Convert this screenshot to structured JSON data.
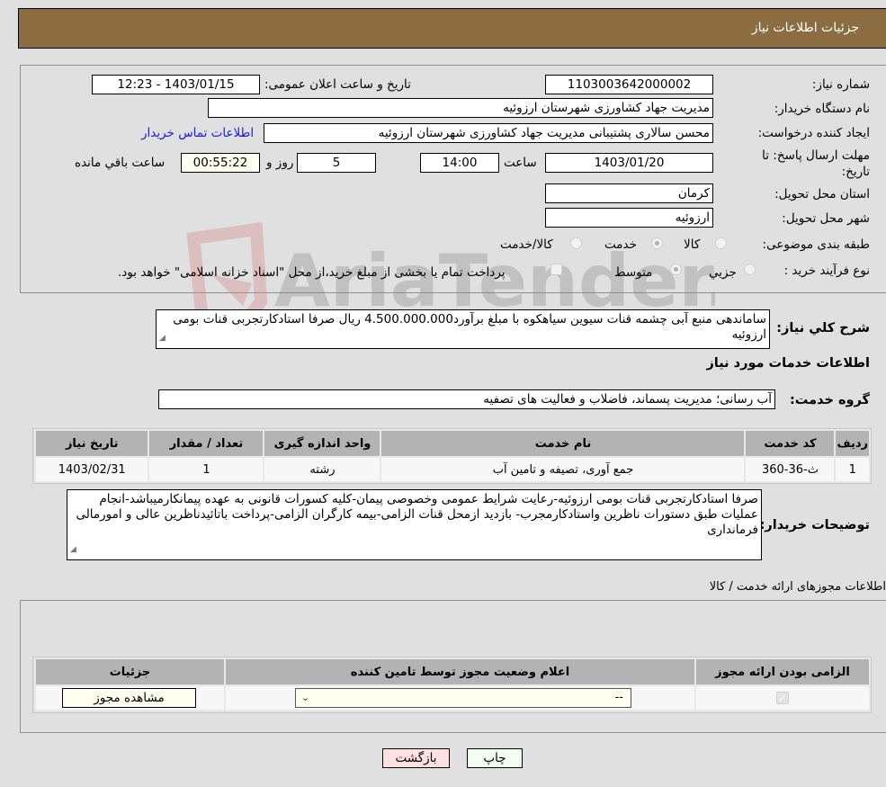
{
  "header": {
    "title": "جزئیات اطلاعات نیاز"
  },
  "form": {
    "need_number_label": "شماره نیاز:",
    "need_number": "1103003642000002",
    "announce_label": "تاریخ و ساعت اعلان عمومی:",
    "announce_value": "1403/01/15 - 12:23",
    "buyer_org_label": "نام دستگاه خریدار:",
    "buyer_org": "مدیریت جهاد کشاورزی شهرستان ارزوئیه",
    "creator_label": "ایجاد کننده درخواست:",
    "creator": "محسن  سالاری پشتیبانی مدیریت جهاد کشاورزی شهرستان ارزوئیه",
    "buyer_contact_link": "اطلاعات تماس خریدار",
    "deadline_label": "مهلت ارسال پاسخ: تا تاریخ:",
    "deadline_date": "1403/01/20",
    "time_label": "ساعت",
    "deadline_time": "14:00",
    "days_value": "5",
    "days_label": "روز و",
    "remaining_time": "00:55:22",
    "remaining_label": "ساعت باقي مانده",
    "province_label": "استان محل تحویل:",
    "province": "کرمان",
    "city_label": "شهر محل تحویل:",
    "city": "ارزوئیه",
    "category_label": "طبقه بندی موضوعی:",
    "category_options": [
      "کالا",
      "خدمت",
      "کالا/خدمت"
    ],
    "category_selected": "خدمت",
    "process_label": "نوع فرآیند خرید :",
    "process_options": [
      "جزیي",
      "متوسط"
    ],
    "process_selected": "متوسط",
    "treasury_note": "پرداخت تمام یا بخشی از مبلغ خرید،از محل \"اسناد خزانه اسلامی\" خواهد بود."
  },
  "description": {
    "label": "شرح کلي نياز:",
    "text": "ساماندهی منبع آبی چشمه قنات سیوین سیاهکوه با مبلغ برآورد4.500.000.000 ریال صرفا استادکارتجربی قنات بومی ارزوئیه"
  },
  "services": {
    "section_title": "اطلاعات خدمات مورد نیاز",
    "group_label": "گروه خدمت:",
    "group_value": "آب رسانی؛ مدیریت پسماند، فاضلاب و فعالیت های تصفیه",
    "table": {
      "headers": [
        "ردیف",
        "کد خدمت",
        "نام خدمت",
        "واحد اندازه گیری",
        "تعداد / مقدار",
        "تاریخ نیاز"
      ],
      "rows": [
        [
          "1",
          "ث-36-360",
          "جمع آوری، تصیفه و تامین آب",
          "رشته",
          "1",
          "1403/02/31"
        ]
      ]
    }
  },
  "buyer_notes": {
    "label": "توضیحات خریدار:",
    "text": "صرفا استادکارتجربی قنات بومی ارزوئیه-رعایت شرایط عمومی وخصوصی پیمان-کلیه کسورات قانونی به عهده پیمانکارمیباشد-انجام عملیات طبق دستورات ناظرین واستادکارمجرب- بازدید ازمحل قنات الزامی-بیمه کارگران الزامی-پرداخت باتائیدناظرین عالی و امورمالی فرمانداری"
  },
  "licenses": {
    "section_title": "اطلاعات مجوزهای ارائه خدمت / کالا",
    "headers": [
      "الزامی بودن ارائه مجوز",
      "اعلام وضعیت مجوز توسط تامین کننده",
      "جزئیات"
    ],
    "row": {
      "required_checked": true,
      "status_selected": "--",
      "view_button": "مشاهده مجوز"
    }
  },
  "footer": {
    "print_button": "چاپ",
    "back_button": "بازگشت"
  },
  "watermark": {
    "text": "AriaTender.neT"
  },
  "colors": {
    "header_bg": "#8c6d42",
    "back_button_bg": "#ffe0e0",
    "print_button_bg": "#f0fff0",
    "link": "#1a1adc"
  }
}
